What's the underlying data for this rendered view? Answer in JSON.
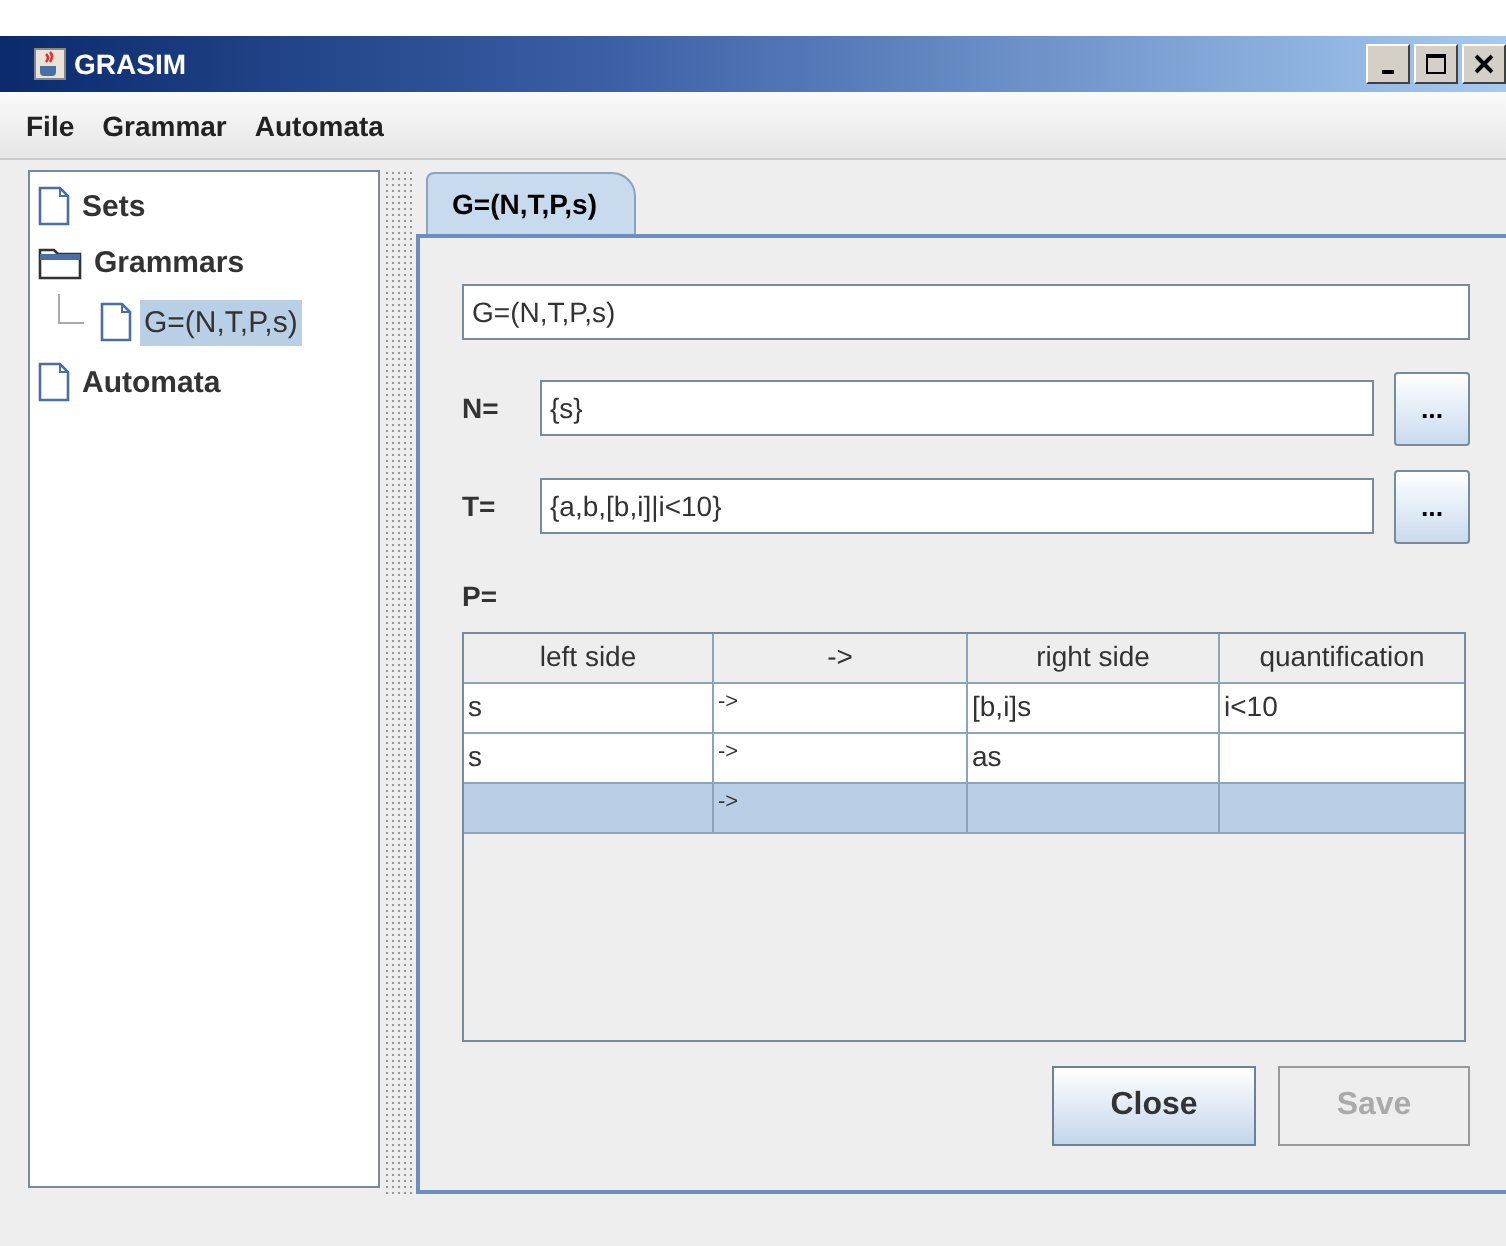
{
  "window": {
    "title": "GRASIM"
  },
  "menu": [
    {
      "label": "File"
    },
    {
      "label": "Grammar"
    },
    {
      "label": "Automata"
    }
  ],
  "tree": [
    {
      "label": "Sets",
      "kind": "file",
      "selected": false
    },
    {
      "label": "Grammars",
      "kind": "folder",
      "selected": false,
      "children": [
        {
          "label": "G=(N,T,P,s)",
          "kind": "file",
          "selected": true
        }
      ]
    },
    {
      "label": "Automata",
      "kind": "file",
      "selected": false
    }
  ],
  "tabs": [
    {
      "label": "G=(N,T,P,s)",
      "selected": true
    }
  ],
  "name_field": {
    "value": "G=(N,T,P,s)"
  },
  "fields": [
    {
      "label": "N=",
      "value": "{s}",
      "button": "..."
    },
    {
      "label": "T=",
      "value": "{a,b,[b,i]|i<10}",
      "button": "..."
    }
  ],
  "productions_label": "P=",
  "table": {
    "columns": [
      "left side",
      "->",
      "right side",
      "quantification"
    ],
    "rows": [
      {
        "cells": [
          "s",
          "->",
          "[b,i]s",
          "i<10"
        ],
        "selected": false
      },
      {
        "cells": [
          "s",
          "->",
          "as",
          ""
        ],
        "selected": false
      },
      {
        "cells": [
          "",
          "->",
          "",
          ""
        ],
        "selected": true
      }
    ]
  },
  "buttons": [
    {
      "label": "Close",
      "disabled": false
    },
    {
      "label": "Save",
      "disabled": true
    }
  ]
}
